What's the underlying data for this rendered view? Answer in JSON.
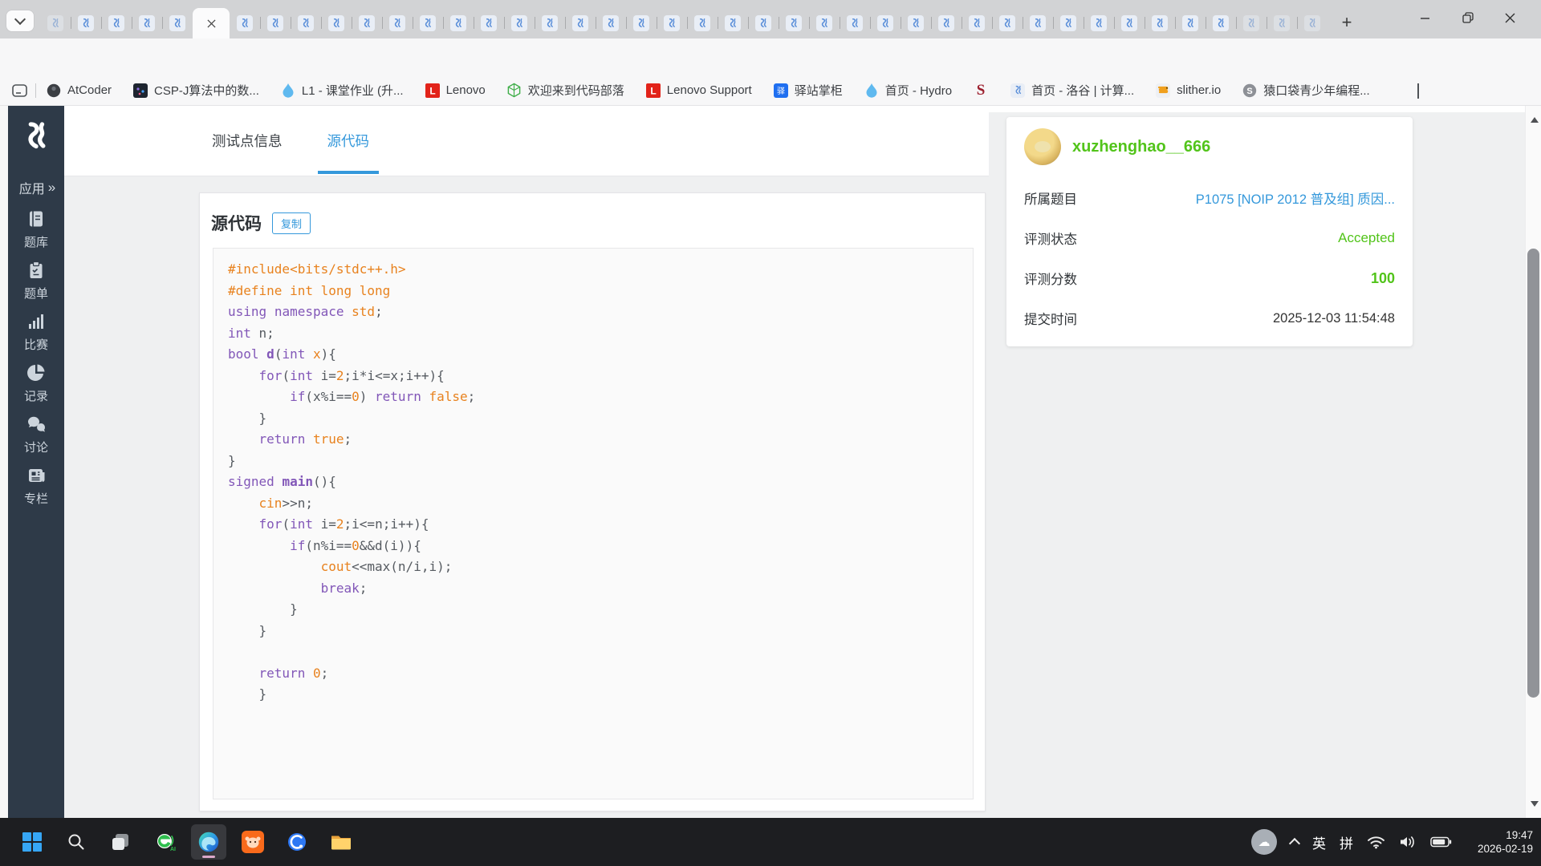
{
  "browser": {
    "url": "https://www.luogu.com.cn/record/251120196",
    "tabs": {
      "count": 42,
      "active_index": 5,
      "faded": [
        0,
        39,
        40,
        41
      ]
    },
    "new_tab_label": "+",
    "bookmarks": [
      {
        "label": "AtCoder",
        "icon": "circle-dark"
      },
      {
        "label": "CSP-J算法中的数...",
        "icon": "square-dark"
      },
      {
        "label": "L1 - 课堂作业 (升...",
        "icon": "drop"
      },
      {
        "label": "Lenovo",
        "icon": "lenovo"
      },
      {
        "label": "欢迎来到代码部落",
        "icon": "cube"
      },
      {
        "label": "Lenovo Support",
        "icon": "lenovo"
      },
      {
        "label": "驿站掌柜",
        "icon": "yi"
      },
      {
        "label": "首页 - Hydro",
        "icon": "drop"
      },
      {
        "label": "",
        "icon": "s-red"
      },
      {
        "label": "首页 - 洛谷 | 计算...",
        "icon": "luogu"
      },
      {
        "label": "slither.io",
        "icon": "slither"
      },
      {
        "label": "猿口袋青少年编程...",
        "icon": "s-gray"
      }
    ]
  },
  "sidebar": {
    "app_label": "应用",
    "items": [
      {
        "key": "problemset",
        "label": "题库",
        "icon": "book-icon"
      },
      {
        "key": "problem-list",
        "label": "题单",
        "icon": "clipboard-icon"
      },
      {
        "key": "contest",
        "label": "比赛",
        "icon": "barchart-icon"
      },
      {
        "key": "record",
        "label": "记录",
        "icon": "piechart-icon"
      },
      {
        "key": "discuss",
        "label": "讨论",
        "icon": "chat-icon"
      },
      {
        "key": "column",
        "label": "专栏",
        "icon": "newspaper-icon"
      }
    ]
  },
  "record_page": {
    "tabs": [
      {
        "label": "测试点信息",
        "active": false
      },
      {
        "label": "源代码",
        "active": true
      }
    ],
    "card_title": "源代码",
    "copy_label": "复制",
    "code_lines": [
      [
        [
          "m",
          "#include<bits/stdc++.h>"
        ]
      ],
      [
        [
          "m",
          "#define int long long"
        ]
      ],
      [
        [
          "k",
          "using"
        ],
        [
          "p",
          " "
        ],
        [
          "k",
          "namespace"
        ],
        [
          "p",
          " "
        ],
        [
          "b",
          "std"
        ],
        [
          "p",
          ";"
        ]
      ],
      [
        [
          "k",
          "int"
        ],
        [
          "p",
          " n;"
        ]
      ],
      [
        [
          "k",
          "bool"
        ],
        [
          "p",
          " "
        ],
        [
          "f",
          "d"
        ],
        [
          "p",
          "("
        ],
        [
          "k",
          "int"
        ],
        [
          "p",
          " "
        ],
        [
          "o",
          "x"
        ],
        [
          "p",
          "){"
        ]
      ],
      [
        [
          "p",
          "    "
        ],
        [
          "k",
          "for"
        ],
        [
          "p",
          "("
        ],
        [
          "k",
          "int"
        ],
        [
          "p",
          " i="
        ],
        [
          "n",
          "2"
        ],
        [
          "p",
          ";i*i<=x;i++){"
        ]
      ],
      [
        [
          "p",
          "        "
        ],
        [
          "k",
          "if"
        ],
        [
          "p",
          "(x%i=="
        ],
        [
          "n",
          "0"
        ],
        [
          "p",
          ") "
        ],
        [
          "k",
          "return"
        ],
        [
          "p",
          " "
        ],
        [
          "b",
          "false"
        ],
        [
          "p",
          ";"
        ]
      ],
      [
        [
          "p",
          "    }"
        ]
      ],
      [
        [
          "p",
          "    "
        ],
        [
          "k",
          "return"
        ],
        [
          "p",
          " "
        ],
        [
          "b",
          "true"
        ],
        [
          "p",
          ";"
        ]
      ],
      [
        [
          "p",
          "}"
        ]
      ],
      [
        [
          "k",
          "signed"
        ],
        [
          "p",
          " "
        ],
        [
          "f",
          "main"
        ],
        [
          "p",
          "(){"
        ]
      ],
      [
        [
          "p",
          "    "
        ],
        [
          "b",
          "cin"
        ],
        [
          "p",
          ">>n;"
        ]
      ],
      [
        [
          "p",
          "    "
        ],
        [
          "k",
          "for"
        ],
        [
          "p",
          "("
        ],
        [
          "k",
          "int"
        ],
        [
          "p",
          " i="
        ],
        [
          "n",
          "2"
        ],
        [
          "p",
          ";i<=n;i++){"
        ]
      ],
      [
        [
          "p",
          "        "
        ],
        [
          "k",
          "if"
        ],
        [
          "p",
          "(n%i=="
        ],
        [
          "n",
          "0"
        ],
        [
          "p",
          "&&d(i)){"
        ]
      ],
      [
        [
          "p",
          "            "
        ],
        [
          "b",
          "cout"
        ],
        [
          "p",
          "<<max(n/i,i);"
        ]
      ],
      [
        [
          "p",
          "            "
        ],
        [
          "k",
          "break"
        ],
        [
          "p",
          ";"
        ]
      ],
      [
        [
          "p",
          "        }"
        ]
      ],
      [
        [
          "p",
          "    }"
        ]
      ],
      [
        [
          "p",
          ""
        ]
      ],
      [
        [
          "p",
          "    "
        ],
        [
          "k",
          "return"
        ],
        [
          "p",
          " "
        ],
        [
          "n",
          "0"
        ],
        [
          "p",
          ";"
        ]
      ],
      [
        [
          "p",
          "    }"
        ]
      ]
    ]
  },
  "info_panel": {
    "username": "xuzhenghao__666",
    "rows": [
      {
        "label": "所属题目",
        "value": "P1075 [NOIP 2012 普及组] 质因...",
        "style": "link"
      },
      {
        "label": "评测状态",
        "value": "Accepted",
        "style": "green"
      },
      {
        "label": "评测分数",
        "value": "100",
        "style": "green-bold"
      },
      {
        "label": "提交时间",
        "value": "2025-12-03 11:54:48",
        "style": "plain"
      }
    ]
  },
  "taskbar": {
    "apps": [
      {
        "name": "start",
        "active": false
      },
      {
        "name": "search",
        "active": false
      },
      {
        "name": "task-view",
        "active": false
      },
      {
        "name": "browser-360",
        "active": false
      },
      {
        "name": "edge",
        "active": true
      },
      {
        "name": "yuan-coding",
        "active": false
      },
      {
        "name": "quark",
        "active": false
      },
      {
        "name": "file-explorer",
        "active": false
      }
    ],
    "tray": {
      "ime": [
        "英",
        "拼"
      ],
      "time": "19:47",
      "date": "2026-02-19"
    }
  },
  "colors": {
    "accent_blue": "#3498db",
    "success_green": "#52c41a",
    "sidebar_bg": "#2e3a48",
    "code_orange": "#e8821e",
    "code_purple": "#8257b8",
    "code_plain": "#565b61",
    "taskbar_bg": "#1d1e21"
  }
}
